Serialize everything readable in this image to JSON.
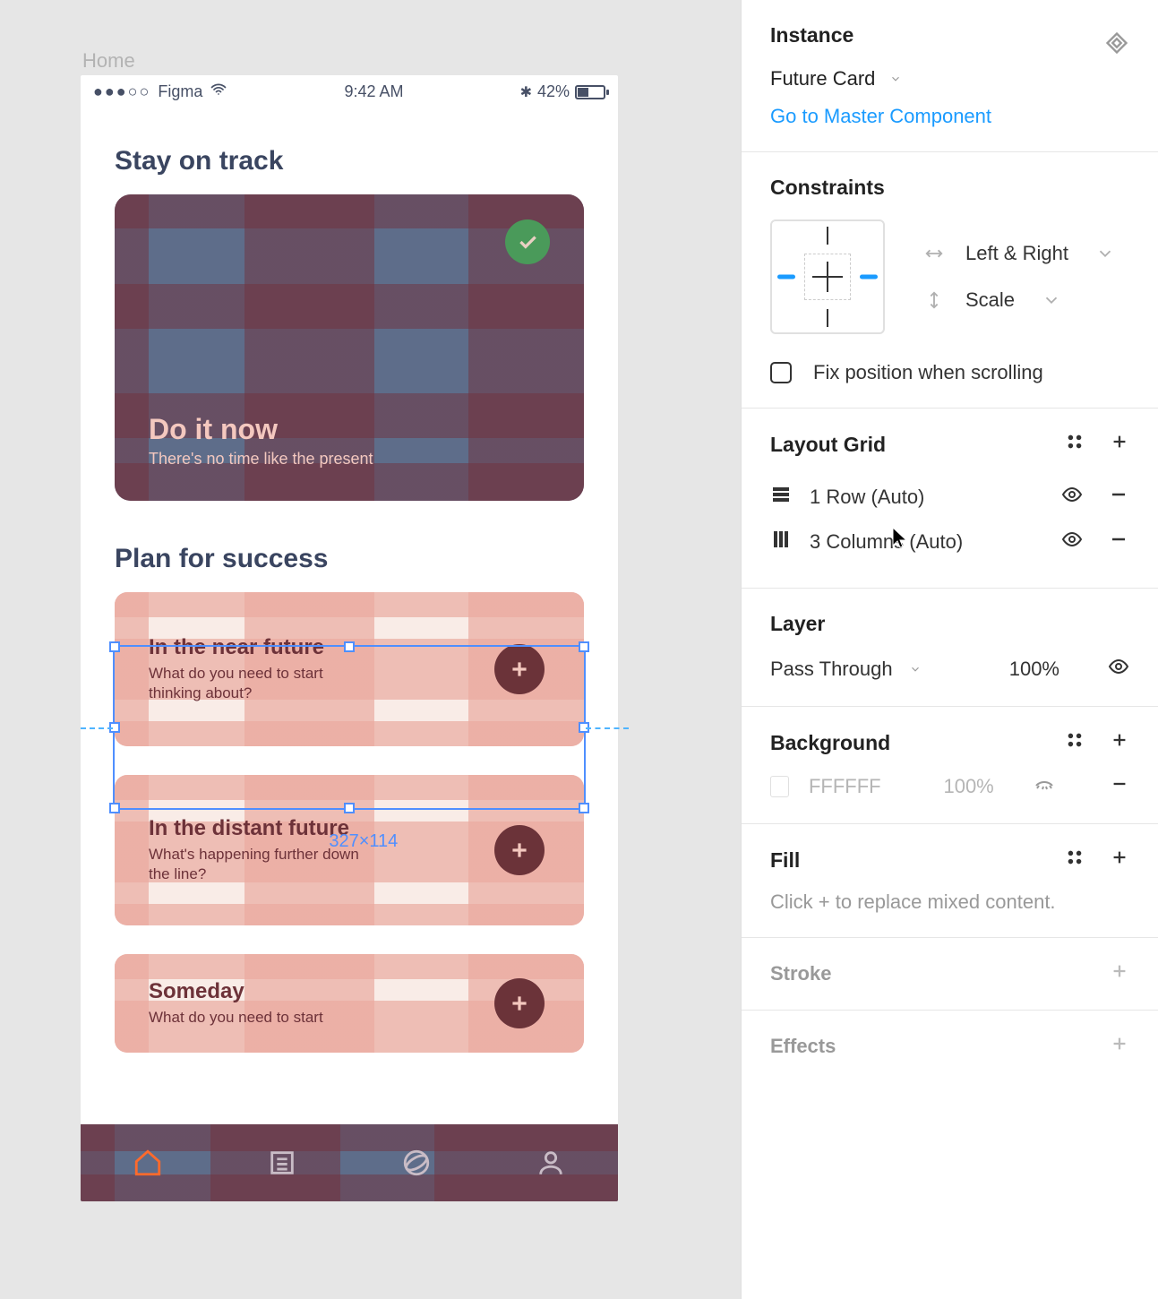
{
  "frame_label": "Home",
  "status_bar": {
    "carrier": "Figma",
    "signal_dots": "●●●○○",
    "time": "9:42 AM",
    "bt": "✱",
    "battery_pct": "42%"
  },
  "sections": {
    "stay": {
      "title": "Stay on track",
      "card": {
        "title": "Do it now",
        "subtitle": "There's no time like the present"
      }
    },
    "plan": {
      "title": "Plan for success",
      "cards": [
        {
          "title": "In the near future",
          "subtitle": "What do you need to start thinking about?"
        },
        {
          "title": "In the distant future",
          "subtitle": "What's happening further down the line?"
        },
        {
          "title": "Someday",
          "subtitle": "What do you need to start"
        }
      ]
    }
  },
  "selection_dims": "327×114",
  "panel": {
    "instance": {
      "header": "Instance",
      "name": "Future Card",
      "link": "Go to Master Component"
    },
    "constraints": {
      "header": "Constraints",
      "horizontal": "Left & Right",
      "vertical": "Scale",
      "fix_label": "Fix position when scrolling"
    },
    "layout_grid": {
      "header": "Layout Grid",
      "rows": [
        {
          "label": "1 Row (Auto)"
        },
        {
          "label": "3 Columns (Auto)"
        }
      ]
    },
    "layer": {
      "header": "Layer",
      "mode": "Pass Through",
      "opacity": "100%"
    },
    "background": {
      "header": "Background",
      "hex": "FFFFFF",
      "opacity": "100%"
    },
    "fill": {
      "header": "Fill",
      "message": "Click + to replace mixed content."
    },
    "stroke": {
      "header": "Stroke"
    },
    "effects": {
      "header": "Effects"
    }
  }
}
